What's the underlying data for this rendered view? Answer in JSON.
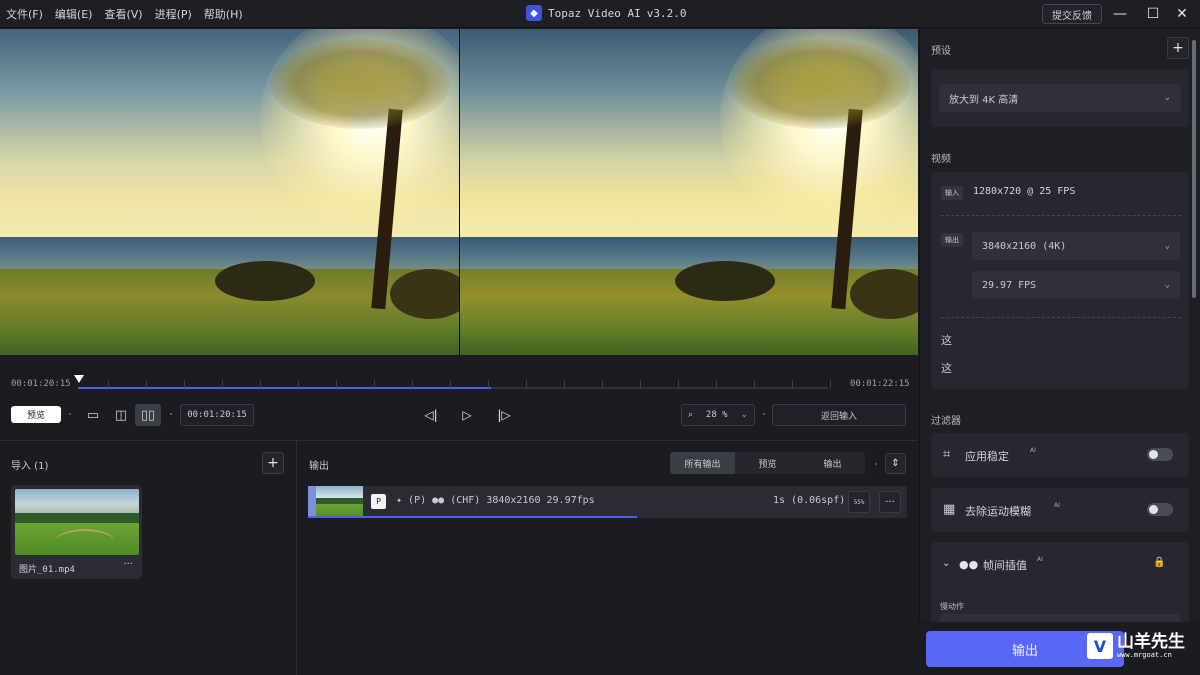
{
  "menu": [
    "文件(F)",
    "编辑(E)",
    "查看(V)",
    "进程(P)",
    "帮助(H)"
  ],
  "app": {
    "title": "Topaz Video AI",
    "version": "v3.2.0"
  },
  "feedback_label": "提交反馈",
  "timeline": {
    "start_time": "00:01:20:15",
    "end_time": "00:01:22:15",
    "progress": 0.55
  },
  "controls": {
    "preview_label": "预览",
    "current_time": "00:01:20:15",
    "zoom": "28 %",
    "return_label": "返回输入"
  },
  "import_panel": {
    "title": "导入 (1)",
    "file_name": "图片_01.mp4",
    "more": "···"
  },
  "output_panel": {
    "title": "输出",
    "tabs": [
      "所有输出",
      "预览",
      "输出"
    ],
    "active_tab": 0,
    "row": {
      "badge": "P",
      "spec": "(P)  ●● (CHF)  3840x2160  29.97fps",
      "time": "1s (0.06spf)",
      "percent": "55%",
      "more": "···",
      "progress": 0.55
    }
  },
  "sidebar": {
    "presets_label": "预设",
    "preset_value": "放大到 4K 高清",
    "video_label": "视频",
    "input_tag": "输入",
    "input_spec": "1280x720 @ 25 FPS",
    "output_tag": "输出",
    "output_resolution": "3840x2160 (4K)",
    "output_fps": "29.97 FPS",
    "extra_1": "这",
    "extra_2": "这",
    "filters_label": "过滤器",
    "filters": [
      {
        "label": "应用稳定",
        "ai": "AI",
        "icon": "stabilize-icon"
      },
      {
        "label": "去除运动模糊",
        "ai": "AI",
        "icon": "motion-blur-icon"
      }
    ],
    "interp": {
      "label": "帧间插值",
      "ai": "AI",
      "sub_label": "慢动作"
    },
    "export_label": "输出"
  },
  "watermark": {
    "big": "山羊先生",
    "small": "www.mrgoat.cn"
  },
  "colors": {
    "accent": "#5a66f5",
    "progress": "#4e5ef1",
    "background": "#1b1c22",
    "panel": "#27282f"
  }
}
